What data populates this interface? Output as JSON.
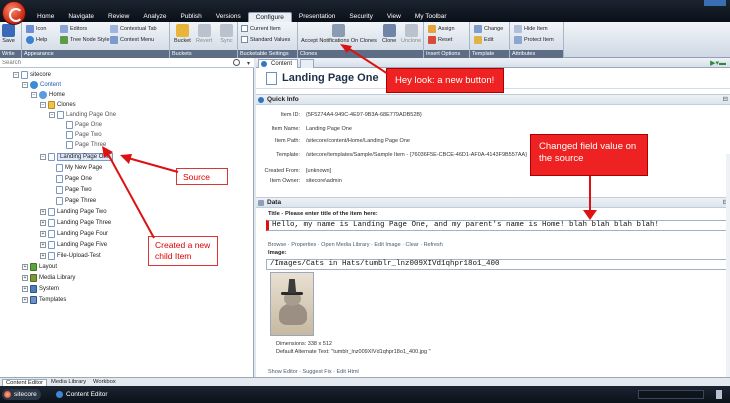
{
  "menu": {
    "tabs": [
      "Home",
      "Navigate",
      "Review",
      "Analyze",
      "Publish",
      "Versions",
      "Configure",
      "Presentation",
      "Security",
      "View",
      "My Toolbar"
    ],
    "active_index": 6
  },
  "ribbon": {
    "write": {
      "label": "Write",
      "save": "Save"
    },
    "appearance": {
      "label": "Appearance",
      "icon": "Icon",
      "help": "Help",
      "editors": "Editors",
      "tree_node_style": "Tree Node Style",
      "contextual_tab": "Contextual Tab",
      "context_menu": "Context Menu"
    },
    "buckets": {
      "label": "Buckets",
      "bucket": "Bucket",
      "revert": "Revert",
      "sync": "Sync"
    },
    "bucketable_settings": {
      "label": "Bucketable Settings",
      "current_item": "Current Item",
      "standard_values": "Standard Values"
    },
    "clones": {
      "label": "Clones",
      "accept_notifications": "Accept Notifications On Clones",
      "clone": "Clone",
      "unclone": "Unclone"
    },
    "insert_options": {
      "label": "Insert Options",
      "assign": "Assign",
      "reset": "Reset"
    },
    "template": {
      "label": "Template",
      "change": "Change",
      "edit": "Edit"
    },
    "attributes": {
      "label": "Attributes",
      "hide_item": "Hide Item",
      "protect_item": "Protect Item"
    }
  },
  "search": {
    "placeholder": "Search"
  },
  "tree": {
    "sitecore": "sitecore",
    "content": "Content",
    "home": "Home",
    "clones": "Clones",
    "clone_lpo": "Landing Page One",
    "clone_page_one": "Page One",
    "clone_page_two": "Page Two",
    "clone_page_three": "Page Three",
    "lpo": "Landing Page One",
    "my_new_page": "My New Page",
    "page_one": "Page One",
    "page_two": "Page Two",
    "page_three": "Page Three",
    "lp_two": "Landing Page Two",
    "lp_three": "Landing Page Three",
    "lp_four": "Landing Page Four",
    "lp_five": "Landing Page Five",
    "file_upload": "File-Upload-Test",
    "layout": "Layout",
    "media_library": "Media Library",
    "system": "System",
    "templates": "Templates"
  },
  "annotations": {
    "new_button": "Hey look: a new button!",
    "source": "Source",
    "child_item": "Created a new child Item",
    "changed_field": "Changed field value on the source"
  },
  "content": {
    "tab_label": "Content",
    "item_title": "Landing Page One",
    "quick_info": {
      "header": "Quick Info",
      "item_id_label": "Item ID:",
      "item_id": "{5F5274A4-949C-4E97-9B3A-68E779ADB52B}",
      "item_name_label": "Item Name:",
      "item_name": "Landing Page One",
      "item_path_label": "Item Path:",
      "item_path": "/sitecore/content/Home/Landing Page One",
      "template_label": "Template:",
      "template": "/sitecore/templates/Sample/Sample Item - {76036F5E-CBCE-46D1-AF0A-4143F9B557AA}",
      "created_from_label": "Created From:",
      "created_from": "[unknown]",
      "item_owner_label": "Item Owner:",
      "item_owner": "sitecore\\admin"
    },
    "data": {
      "header": "Data",
      "title_label": "Title - Please enter title of the item here:",
      "title_value": "Hello, my name is Landing Page One, and my parent's name is Home! blah blah blah blah!",
      "image_links": "Browse · Properties · Open Media Library · Edit Image · Clear · Refresh",
      "image_label": "Image:",
      "image_path": "/Images/Cats in Hats/tumblr_lnz009XIVd1qhpr18o1_400",
      "dimensions": "Dimensions: 338 x 512",
      "alt_text": "Default Alternate Text: \"tumblr_lnz009XIVd1qhpr18o1_400.jpg \"",
      "bottom_links": "Show Editor · Suggest Fix · Edit Html"
    }
  },
  "editor_tabs": [
    "Content Editor",
    "Media Library",
    "Workbox"
  ],
  "taskbar": {
    "start": "sitecore",
    "item": "Content Editor"
  },
  "colors": {
    "accent": "#2c78c9",
    "annotation": "#ee2222"
  }
}
